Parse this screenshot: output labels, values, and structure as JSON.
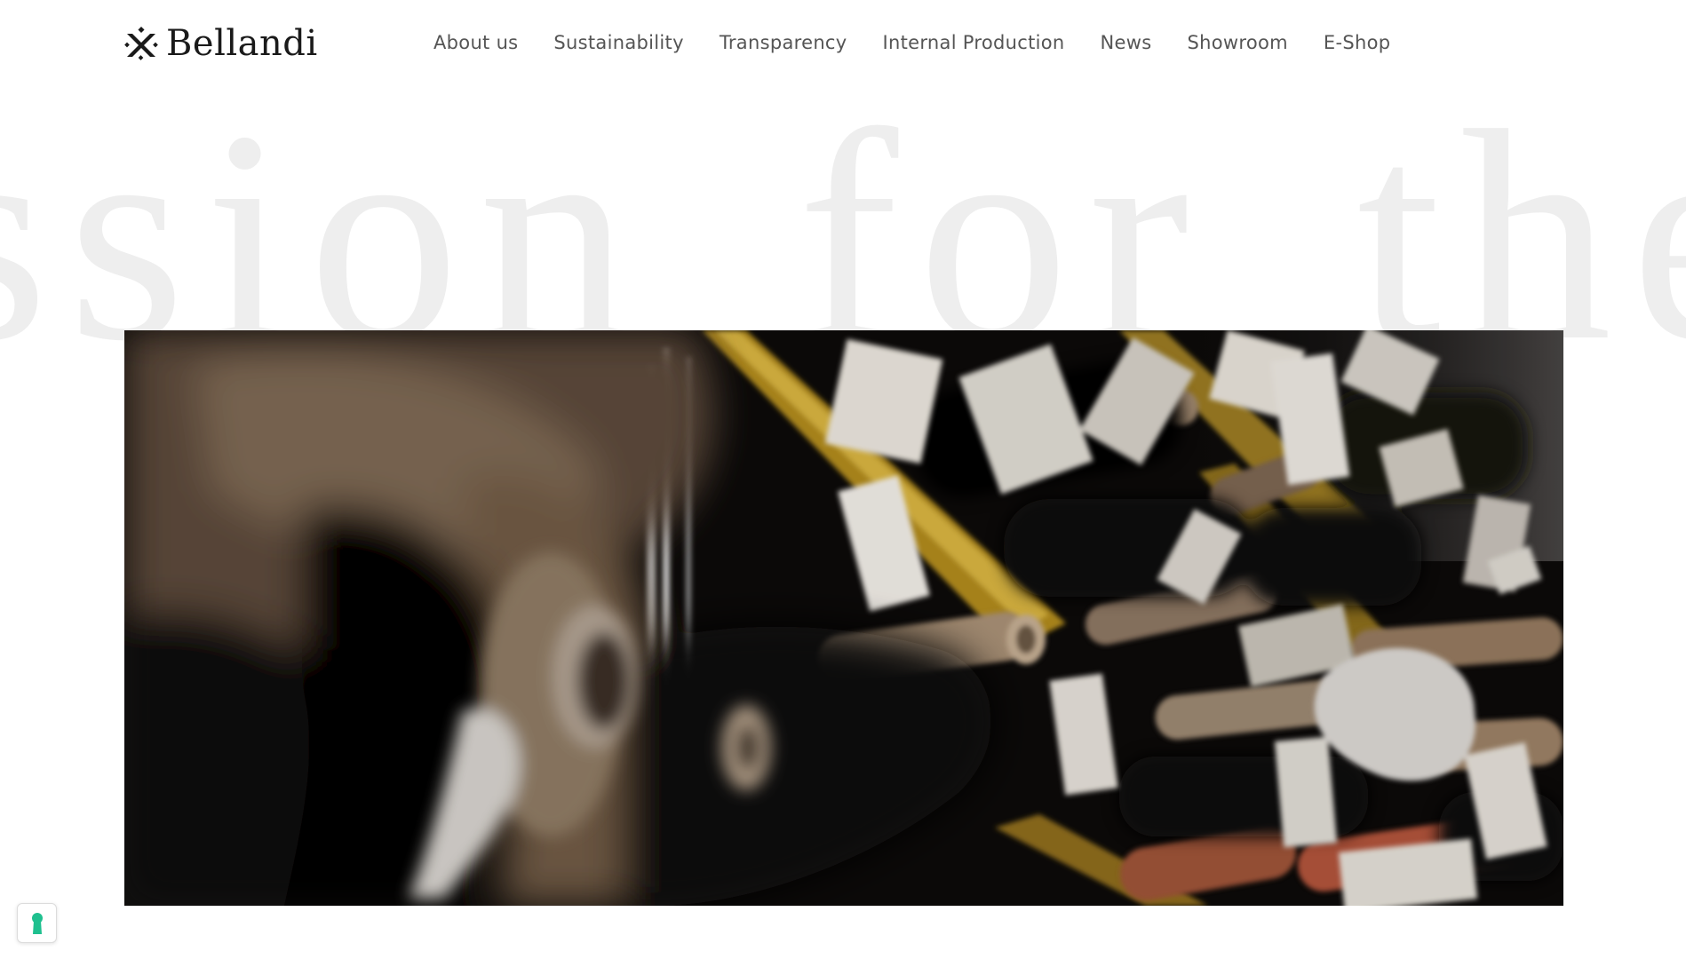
{
  "brand": {
    "name": "Bellandi",
    "logo_icon": "bellandi-logo-mark"
  },
  "nav": {
    "items": [
      {
        "label": "About us"
      },
      {
        "label": "Sustainability"
      },
      {
        "label": "Transparency"
      },
      {
        "label": "Internal Production"
      },
      {
        "label": "News"
      },
      {
        "label": "Showroom"
      },
      {
        "label": "E-Shop"
      }
    ]
  },
  "hero": {
    "background_headline": "ssion for the",
    "media": "video-fabric-rolls-warehouse"
  },
  "privacy": {
    "icon": "keyhole-icon",
    "accent_color": "#1fc08f"
  },
  "colors": {
    "text": "#1a1a1a",
    "nav_text": "#555555",
    "headline_watermark": "#eeeeee",
    "background": "#ffffff"
  }
}
